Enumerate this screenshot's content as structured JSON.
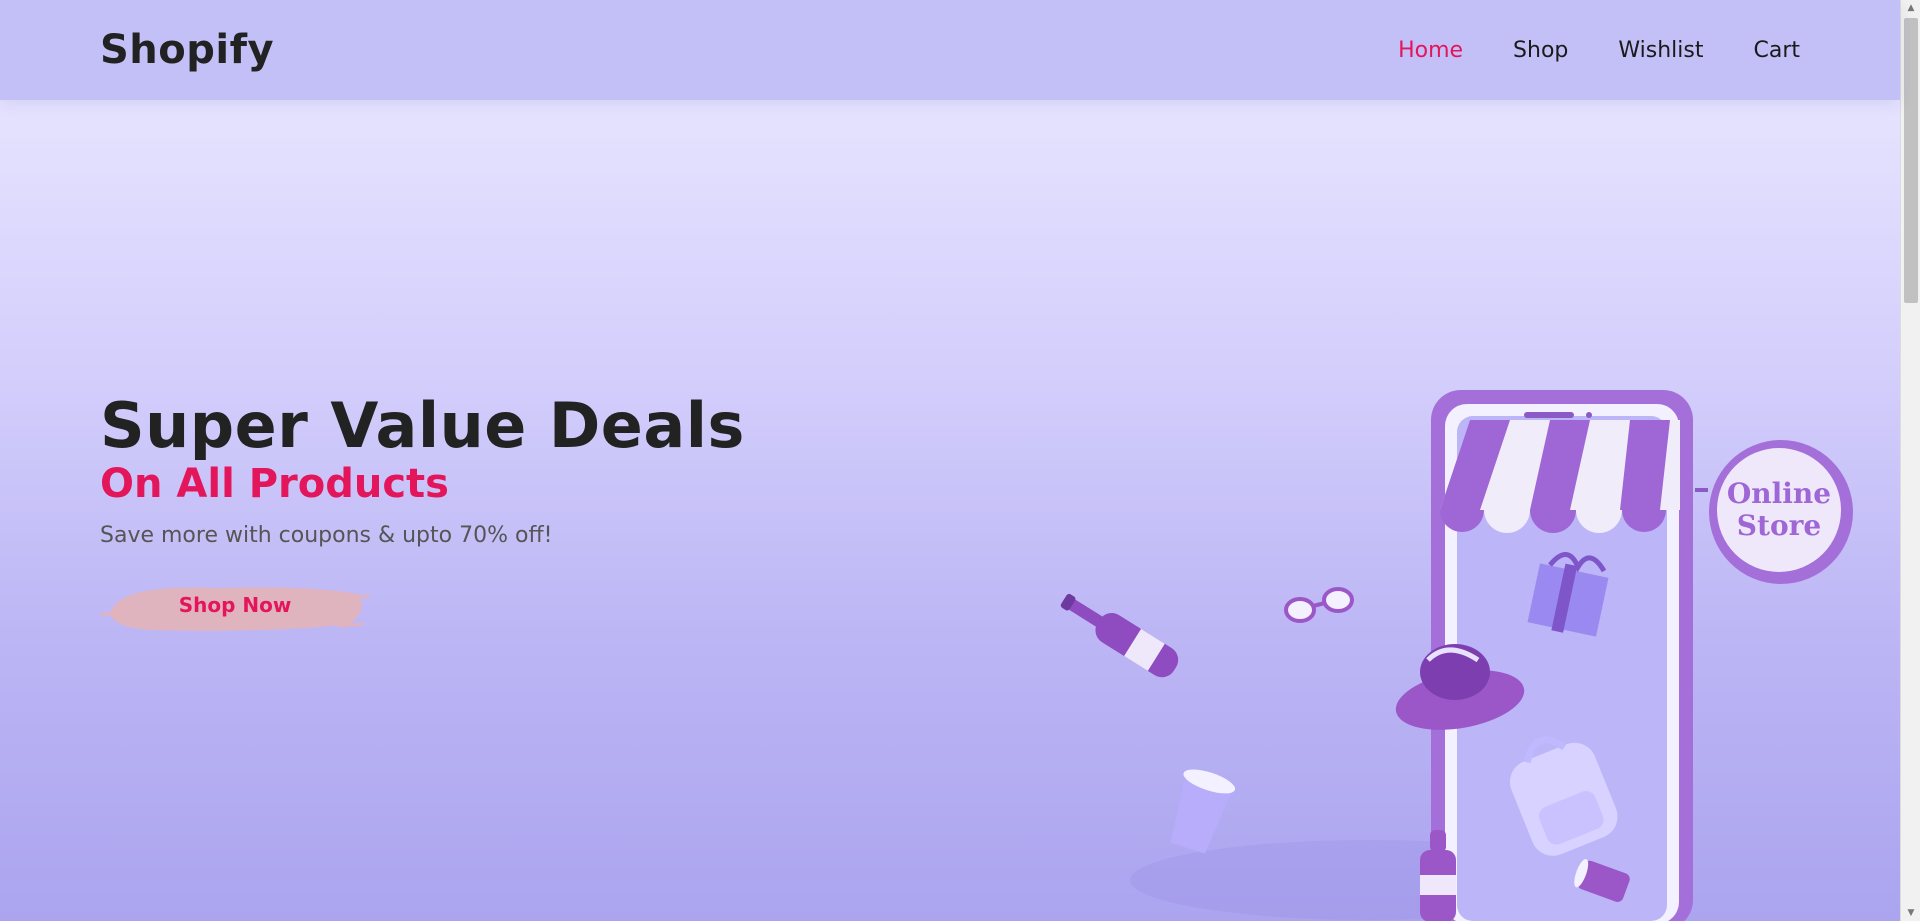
{
  "header": {
    "logo": "Shopify",
    "nav": [
      {
        "label": "Home",
        "active": true
      },
      {
        "label": "Shop",
        "active": false
      },
      {
        "label": "Wishlist",
        "active": false
      },
      {
        "label": "Cart",
        "active": false
      }
    ]
  },
  "hero": {
    "title": "Super Value Deals",
    "subtitle": "On All Products",
    "description": "Save more with coupons & upto 70% off!",
    "cta_label": "Shop Now",
    "store_sign": {
      "line1": "Online",
      "line2": "Store"
    }
  },
  "colors": {
    "header_bg": "#c3c0f7",
    "accent": "#e3165b",
    "hero_top": "#e6e3ff",
    "hero_bottom": "#aba4ef",
    "illustration_purple": "#9b6bd6"
  }
}
